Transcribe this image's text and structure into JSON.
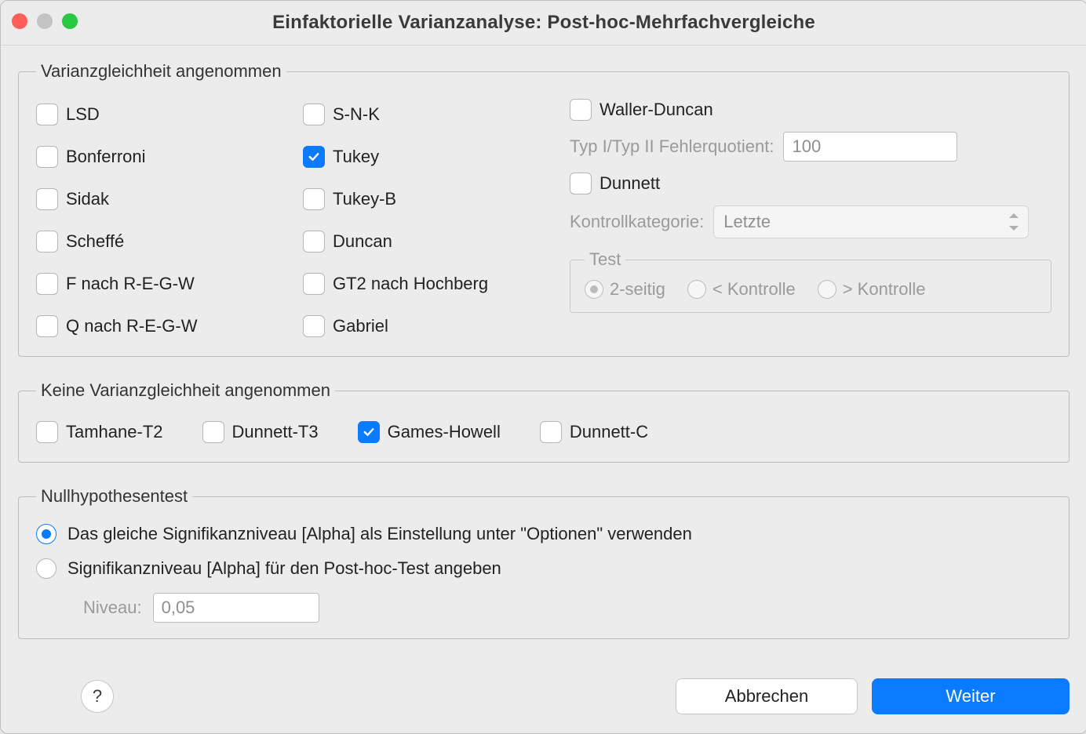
{
  "window": {
    "title": "Einfaktorielle Varianzanalyse: Post-hoc-Mehrfachvergleiche"
  },
  "equal_var": {
    "legend": "Varianzgleichheit angenommen",
    "col1": [
      {
        "key": "lsd",
        "label": "LSD",
        "checked": false
      },
      {
        "key": "bonferroni",
        "label": "Bonferroni",
        "checked": false
      },
      {
        "key": "sidak",
        "label": "Sidak",
        "checked": false
      },
      {
        "key": "scheffe",
        "label": "Scheffé",
        "checked": false
      },
      {
        "key": "regw_f",
        "label": "F nach R-E-G-W",
        "checked": false
      },
      {
        "key": "regw_q",
        "label": "Q nach R-E-G-W",
        "checked": false
      }
    ],
    "col2": [
      {
        "key": "snk",
        "label": "S-N-K",
        "checked": false
      },
      {
        "key": "tukey",
        "label": "Tukey",
        "checked": true
      },
      {
        "key": "tukey_b",
        "label": "Tukey-B",
        "checked": false
      },
      {
        "key": "duncan",
        "label": "Duncan",
        "checked": false
      },
      {
        "key": "hochberg",
        "label": "GT2 nach Hochberg",
        "checked": false
      },
      {
        "key": "gabriel",
        "label": "Gabriel",
        "checked": false
      }
    ],
    "right": {
      "waller_duncan": {
        "label": "Waller-Duncan",
        "checked": false
      },
      "error_ratio_label": "Typ I/Typ II Fehlerquotient:",
      "error_ratio_value": "100",
      "dunnett": {
        "label": "Dunnett",
        "checked": false
      },
      "control_cat_label": "Kontrollkategorie:",
      "control_cat_value": "Letzte",
      "test": {
        "legend": "Test",
        "two_sided": "2-seitig",
        "lt_control": "< Kontrolle",
        "gt_control": "> Kontrolle",
        "selected": "two_sided"
      }
    }
  },
  "unequal_var": {
    "legend": "Keine Varianzgleichheit angenommen",
    "items": [
      {
        "key": "tamhane",
        "label": "Tamhane-T2",
        "checked": false
      },
      {
        "key": "dunnett_t3",
        "label": "Dunnett-T3",
        "checked": false
      },
      {
        "key": "games_howell",
        "label": "Games-Howell",
        "checked": true
      },
      {
        "key": "dunnett_c",
        "label": "Dunnett-C",
        "checked": false
      }
    ]
  },
  "null_hyp": {
    "legend": "Nullhypothesentest",
    "opt_same": "Das gleiche Signifikanzniveau [Alpha] als Einstellung unter \"Optionen\" verwenden",
    "opt_specify": "Signifikanzniveau [Alpha] für den Post-hoc-Test angeben",
    "selected": "same",
    "level_label": "Niveau:",
    "level_value": "0,05"
  },
  "buttons": {
    "help": "?",
    "cancel": "Abbrechen",
    "continue": "Weiter"
  }
}
